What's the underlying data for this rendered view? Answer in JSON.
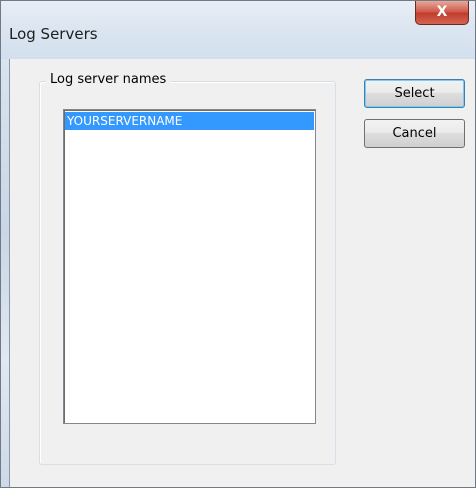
{
  "window": {
    "title": "Log Servers",
    "close_glyph": "X"
  },
  "group": {
    "label": "Log server names"
  },
  "list": {
    "items": [
      "YOURSERVERNAME"
    ],
    "selected_index": 0
  },
  "buttons": {
    "select_label": "Select",
    "cancel_label": "Cancel"
  },
  "icons": {
    "close": "close-icon"
  },
  "colors": {
    "selection": "#3399ff",
    "close_button": "#c13b2b",
    "dialog_background": "#f0f0f0"
  }
}
